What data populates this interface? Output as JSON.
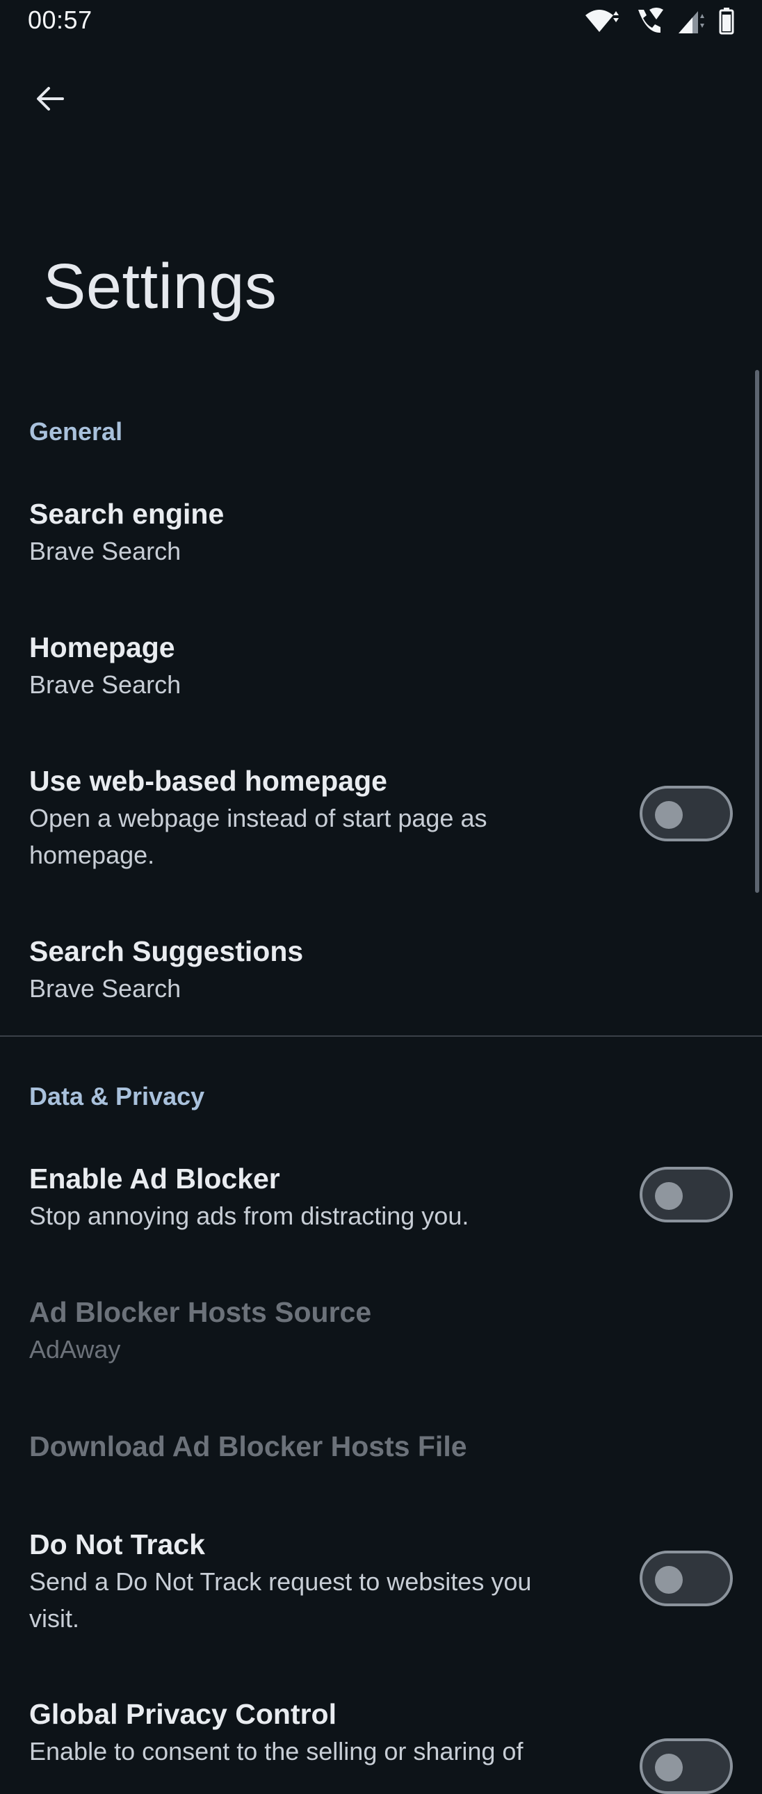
{
  "status_bar": {
    "time": "00:57",
    "icons": [
      "wifi-icon",
      "wifi-calling-icon",
      "cell-signal-icon",
      "battery-icon"
    ]
  },
  "toolbar": {
    "back_icon": "arrow-left-icon"
  },
  "page": {
    "title": "Settings"
  },
  "sections": {
    "general": {
      "header": "General",
      "search_engine": {
        "title": "Search engine",
        "summary": "Brave Search"
      },
      "homepage": {
        "title": "Homepage",
        "summary": "Brave Search"
      },
      "web_homepage": {
        "title": "Use web-based homepage",
        "summary": "Open a webpage instead of start page as homepage.",
        "enabled": false
      },
      "search_suggestions": {
        "title": "Search Suggestions",
        "summary": "Brave Search"
      }
    },
    "privacy": {
      "header": "Data & Privacy",
      "ad_blocker": {
        "title": "Enable Ad Blocker",
        "summary": "Stop annoying ads from distracting you.",
        "enabled": false
      },
      "hosts_source": {
        "title": "Ad Blocker Hosts Source",
        "summary": "AdAway"
      },
      "download_hosts": {
        "title": "Download Ad Blocker Hosts File"
      },
      "do_not_track": {
        "title": "Do Not Track",
        "summary": "Send a Do Not Track request to websites you visit.",
        "enabled": false
      },
      "gpc": {
        "title": "Global Privacy Control",
        "summary": "Enable to consent to the selling or sharing of",
        "enabled": false
      }
    }
  },
  "colors": {
    "background": "#0d1318",
    "section_header": "#a9c1dc",
    "disabled_text": "#6c727a"
  }
}
